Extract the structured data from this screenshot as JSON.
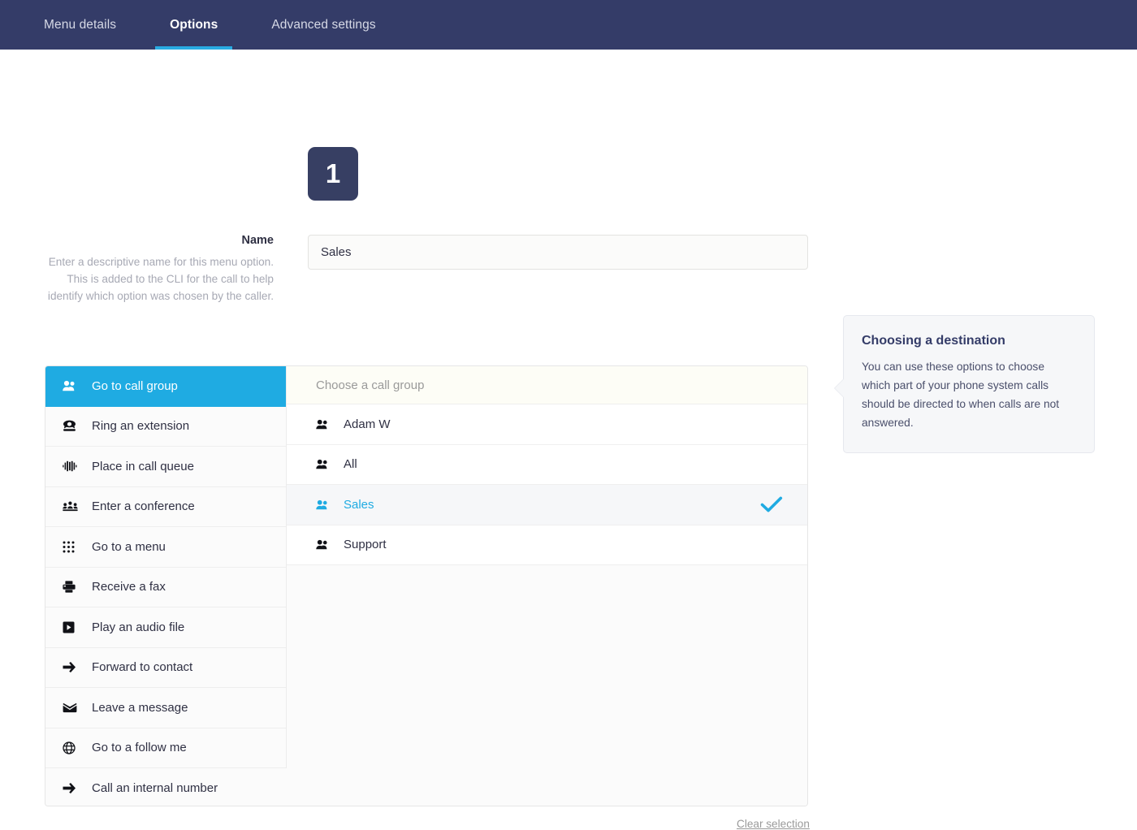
{
  "nav": {
    "tabs": [
      {
        "label": "Menu details",
        "active": false
      },
      {
        "label": "Options",
        "active": true
      },
      {
        "label": "Advanced settings",
        "active": false
      }
    ],
    "accent_color": "#29abe2",
    "bar_color": "#343c68"
  },
  "option": {
    "number": "1"
  },
  "name_field": {
    "label": "Name",
    "help": "Enter a descriptive name for this menu option. This is added to the CLI for the call to help identify which option was chosen by the caller.",
    "value": "Sales",
    "placeholder": ""
  },
  "destinations": {
    "items": [
      {
        "label": "Go to call group",
        "icon": "users-icon",
        "selected": true
      },
      {
        "label": "Ring an extension",
        "icon": "telephone-icon",
        "selected": false
      },
      {
        "label": "Place in call queue",
        "icon": "queue-bars-icon",
        "selected": false
      },
      {
        "label": "Enter a conference",
        "icon": "conference-icon",
        "selected": false
      },
      {
        "label": "Go to a menu",
        "icon": "keypad-grid-icon",
        "selected": false
      },
      {
        "label": "Receive a fax",
        "icon": "fax-printer-icon",
        "selected": false
      },
      {
        "label": "Play an audio file",
        "icon": "play-square-icon",
        "selected": false
      },
      {
        "label": "Forward to contact",
        "icon": "arrow-right-icon",
        "selected": false
      },
      {
        "label": "Leave a message",
        "icon": "envelope-icon",
        "selected": false
      },
      {
        "label": "Go to a follow me",
        "icon": "globe-icon",
        "selected": false
      },
      {
        "label": "Call an internal number",
        "icon": "arrow-right-icon",
        "selected": false
      }
    ]
  },
  "call_groups": {
    "header": "Choose a call group",
    "items": [
      {
        "label": "Adam W",
        "icon": "users-icon",
        "selected": false
      },
      {
        "label": "All",
        "icon": "users-icon",
        "selected": false
      },
      {
        "label": "Sales",
        "icon": "users-icon",
        "selected": true
      },
      {
        "label": "Support",
        "icon": "users-icon",
        "selected": false
      }
    ],
    "selected_color": "#1fabe2",
    "check_icon": "check-icon"
  },
  "tooltip": {
    "title": "Choosing a destination",
    "body": "You can use these options to choose which part of your phone system calls should be directed to when calls are not answered."
  },
  "footer": {
    "clear_label": "Clear selection"
  }
}
